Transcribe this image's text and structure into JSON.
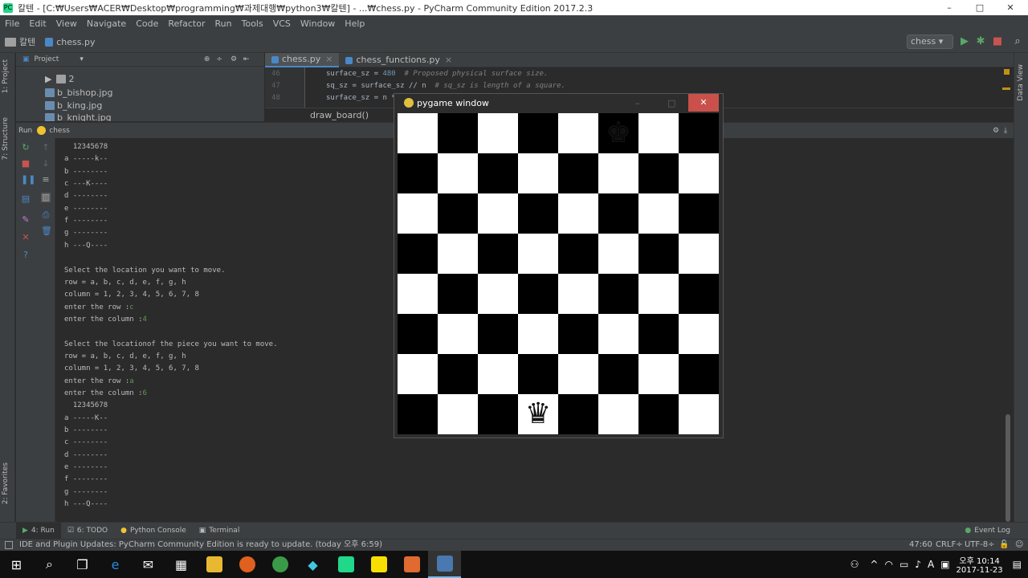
{
  "window": {
    "title": "칼텐 - [C:₩Users₩ACER₩Desktop₩programming₩과제대행₩python3₩칼텐] - ...₩chess.py - PyCharm Community Edition 2017.2.3",
    "min": "–",
    "max": "□",
    "close": "✕"
  },
  "menu": [
    "File",
    "Edit",
    "View",
    "Navigate",
    "Code",
    "Refactor",
    "Run",
    "Tools",
    "VCS",
    "Window",
    "Help"
  ],
  "nav": {
    "project": "칼텐",
    "file": "chess.py",
    "run_config": "chess ▾"
  },
  "project": {
    "header": "Project",
    "items": [
      "2",
      "b_bishop.jpg",
      "b_king.jpg",
      "b_knight.jpg"
    ]
  },
  "editor": {
    "tabs": [
      "chess.py",
      "chess_functions.py"
    ],
    "lines": [
      {
        "n": "46",
        "code": "surface_sz = ",
        "num": "480",
        "comment": "  # Proposed physical surface size."
      },
      {
        "n": "47",
        "code": "sq_sz = surface_sz // n",
        "num": "",
        "comment": "  # sq_sz is length of a square."
      },
      {
        "n": "48",
        "code": "surface_sz = n * ",
        "num": "",
        "comment": ""
      }
    ],
    "breadcrumb": "draw_board()"
  },
  "run": {
    "label": "Run",
    "config": "chess"
  },
  "console": [
    {
      "t": "  12345678"
    },
    {
      "t": "a -----k--"
    },
    {
      "t": "b --------"
    },
    {
      "t": "c ---K----"
    },
    {
      "t": "d --------"
    },
    {
      "t": "e --------"
    },
    {
      "t": "f --------"
    },
    {
      "t": "g --------"
    },
    {
      "t": "h ---Q----"
    },
    {
      "t": ""
    },
    {
      "t": "Select the location you want to move."
    },
    {
      "t": "row = a, b, c, d, e, f, g, h"
    },
    {
      "t": "column = 1, 2, 3, 4, 5, 6, 7, 8"
    },
    {
      "t": "enter the row :",
      "in": "c"
    },
    {
      "t": "enter the column :",
      "in": "4"
    },
    {
      "t": ""
    },
    {
      "t": "Select the locationof the piece you want to move."
    },
    {
      "t": "row = a, b, c, d, e, f, g, h"
    },
    {
      "t": "column = 1, 2, 3, 4, 5, 6, 7, 8"
    },
    {
      "t": "enter the row :",
      "in": "a"
    },
    {
      "t": "enter the column :",
      "in": "6"
    },
    {
      "t": "  12345678"
    },
    {
      "t": "a -----K--"
    },
    {
      "t": "b --------"
    },
    {
      "t": "c --------"
    },
    {
      "t": "d --------"
    },
    {
      "t": "e --------"
    },
    {
      "t": "f --------"
    },
    {
      "t": "g --------"
    },
    {
      "t": "h ---Q----"
    }
  ],
  "bottom_tabs": [
    "4: Run",
    "6: TODO",
    "Python Console",
    "Terminal"
  ],
  "event_log": "Event Log",
  "status": {
    "message": "IDE and Plugin Updates: PyCharm Community Edition is ready to update. (today 오후 6:59)",
    "position": "47:60",
    "line_sep": "CRLF÷",
    "encoding": "UTF-8÷"
  },
  "side_labels": {
    "project": "1: Project",
    "structure": "7: Structure",
    "favorites": "2: Favorites",
    "data_view": "Data View"
  },
  "pygame": {
    "title": "pygame window",
    "close": "✕",
    "pieces": [
      {
        "row": 0,
        "col": 5,
        "glyph": "♚",
        "name": "black-king-piece"
      },
      {
        "row": 7,
        "col": 3,
        "glyph": "♛",
        "name": "black-queen-piece"
      }
    ]
  },
  "taskbar": {
    "time": "오후 10:14",
    "date": "2017-11-23",
    "lang": "A"
  }
}
